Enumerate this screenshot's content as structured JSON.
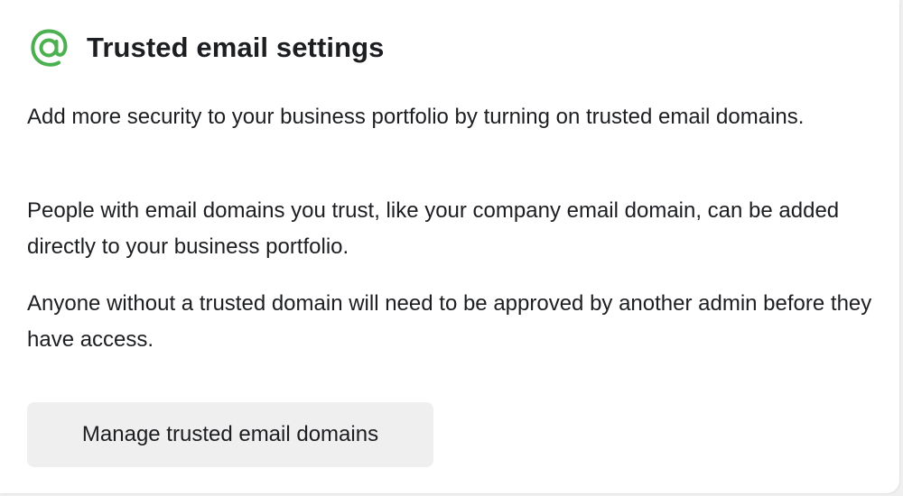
{
  "card": {
    "title": "Trusted email settings",
    "icon": "at-sign-icon",
    "accent_color": "#4caf50",
    "paragraphs": [
      "Add more security to your business portfolio by turning on trusted email domains.",
      "People with email domains you trust, like your company email domain, can be added directly to your business portfolio.",
      "Anyone without a trusted domain will need to be approved by another admin before they have access."
    ],
    "button_label": "Manage trusted email domains"
  }
}
